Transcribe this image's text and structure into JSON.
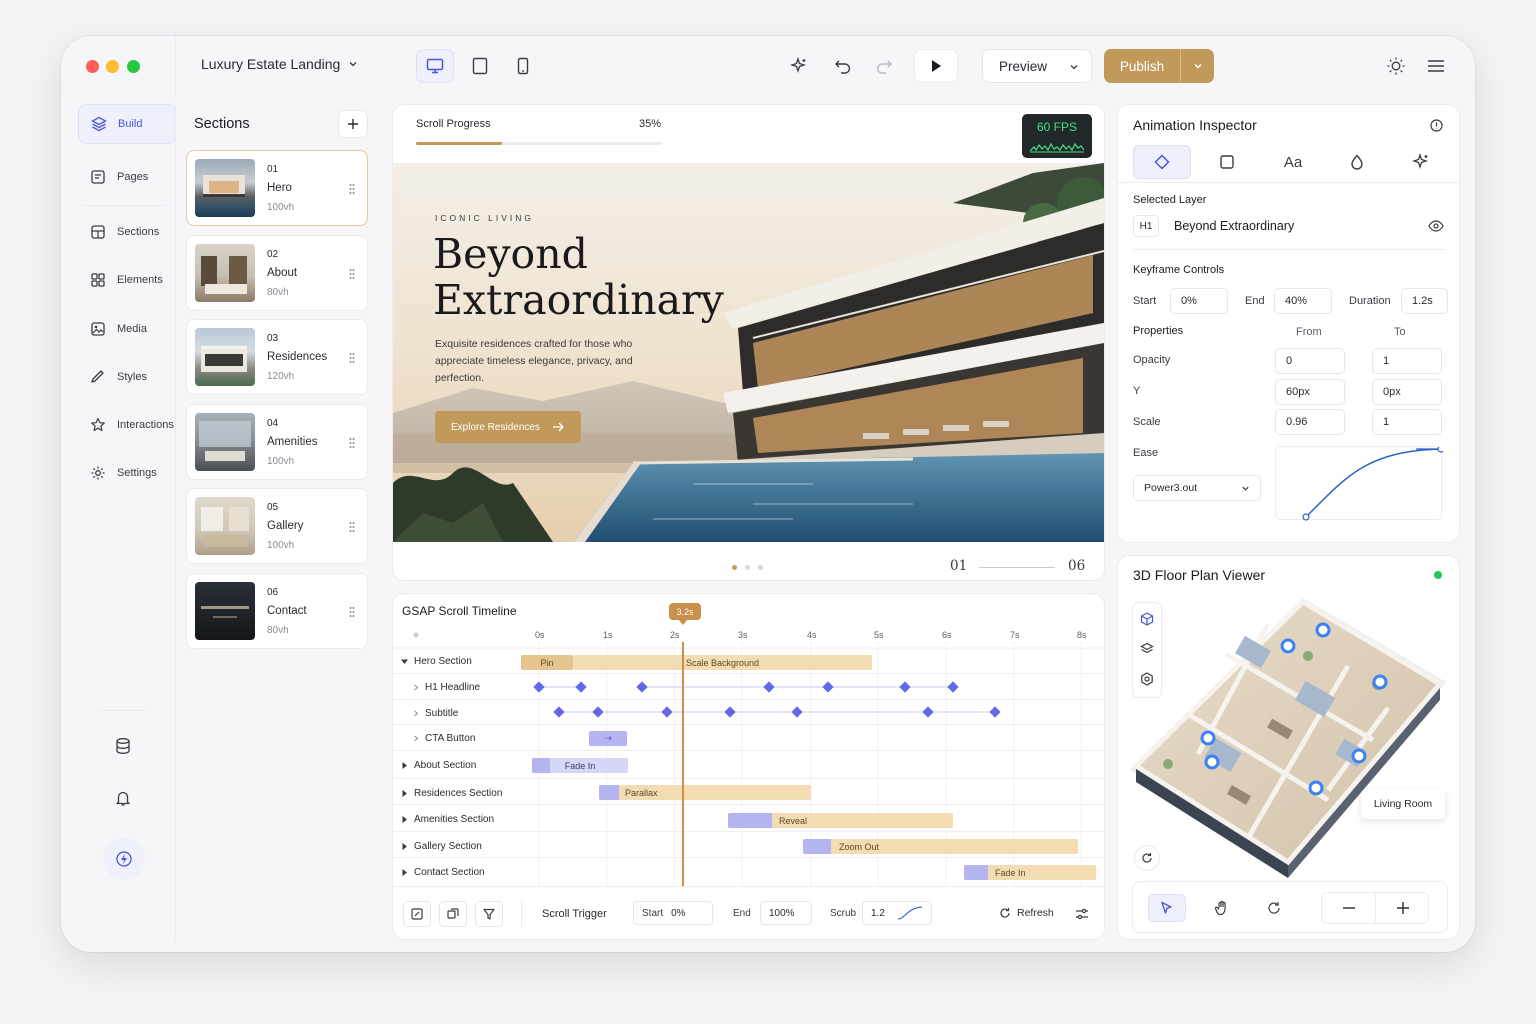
{
  "project": {
    "name": "Luxury Estate Landing"
  },
  "toolbar": {
    "preview_label": "Preview",
    "publish_label": "Publish"
  },
  "nav": {
    "items": [
      {
        "label": "Build",
        "icon": "layers-icon"
      },
      {
        "label": "Pages",
        "icon": "page-icon"
      },
      {
        "label": "Sections",
        "icon": "sections-icon"
      },
      {
        "label": "Elements",
        "icon": "grid-icon"
      },
      {
        "label": "Media",
        "icon": "image-icon"
      },
      {
        "label": "Styles",
        "icon": "brush-icon"
      },
      {
        "label": "Interactions",
        "icon": "sparkle-icon"
      },
      {
        "label": "Settings",
        "icon": "gear-icon"
      }
    ]
  },
  "sections": {
    "title": "Sections",
    "items": [
      {
        "num": "01",
        "name": "Hero",
        "vh": "100vh"
      },
      {
        "num": "02",
        "name": "About",
        "vh": "80vh"
      },
      {
        "num": "03",
        "name": "Residences",
        "vh": "120vh"
      },
      {
        "num": "04",
        "name": "Amenities",
        "vh": "100vh"
      },
      {
        "num": "05",
        "name": "Gallery",
        "vh": "100vh"
      },
      {
        "num": "06",
        "name": "Contact",
        "vh": "80vh"
      }
    ]
  },
  "canvas": {
    "scroll_label": "Scroll Progress",
    "scroll_value": "35%",
    "scroll_fraction": 0.35,
    "fps": "60 FPS",
    "eyebrow": "ICONIC LIVING",
    "headline_1": "Beyond",
    "headline_2": "Extraordinary",
    "body": "Exquisite residences crafted for those who appreciate timeless elegance, privacy, and perfection.",
    "cta": "Explore Residences",
    "slide_start": "01",
    "slide_end": "06"
  },
  "timeline": {
    "title": "GSAP Scroll Timeline",
    "playhead": "3.2s",
    "ticks": [
      "0s",
      "1s",
      "2s",
      "3s",
      "4s",
      "5s",
      "6s",
      "7s",
      "8s"
    ],
    "rows": [
      {
        "label": "Hero Section"
      },
      {
        "label": "H1 Headline"
      },
      {
        "label": "Subtitle"
      },
      {
        "label": "CTA Button"
      },
      {
        "label": "About Section"
      },
      {
        "label": "Residences Section"
      },
      {
        "label": "Amenities Section"
      },
      {
        "label": "Gallery Section"
      },
      {
        "label": "Contact Section"
      }
    ],
    "bars": {
      "pin": "Pin",
      "scale_bg": "Scale Background",
      "fade_in": "Fade In",
      "parallax": "Parallax",
      "reveal": "Reveal",
      "zoom_out": "Zoom Out",
      "fade_in_2": "Fade In"
    },
    "footer": {
      "trigger": "Scroll Trigger",
      "start_label": "Start",
      "start_value": "0%",
      "end_label": "End",
      "end_value": "100%",
      "scrub_label": "Scrub",
      "scrub_value": "1.2",
      "refresh": "Refresh"
    }
  },
  "inspector": {
    "title": "Animation Inspector",
    "selected_label": "Selected Layer",
    "layer_tag": "H1",
    "layer_name": "Beyond Extraordinary",
    "keyframe_title": "Keyframe Controls",
    "start_label": "Start",
    "start_value": "0%",
    "end_label": "End",
    "end_value": "40%",
    "duration_label": "Duration",
    "duration_value": "1.2s",
    "props_title": "Properties",
    "from_label": "From",
    "to_label": "To",
    "opacity_label": "Opacity",
    "opacity_from": "0",
    "opacity_to": "1",
    "y_label": "Y",
    "y_from": "60px",
    "y_to": "0px",
    "scale_label": "Scale",
    "scale_from": "0.96",
    "scale_to": "1",
    "ease_label": "Ease",
    "ease_value": "Power3.out",
    "font_tab": "Aa"
  },
  "floorplan": {
    "title": "3D Floor Plan Viewer",
    "tooltip": "Living Room",
    "status_color": "#22c55e"
  },
  "colors": {
    "accent": "#c19a5b",
    "primary": "#4a55d8",
    "keyframe": "#6468e6"
  }
}
